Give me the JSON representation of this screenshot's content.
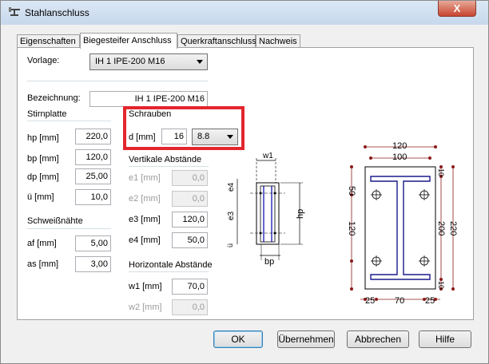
{
  "window": {
    "title": "Stahlanschluss",
    "close_label": "X"
  },
  "tabs": [
    {
      "label": "Eigenschaften"
    },
    {
      "label": "Biegesteifer Anschluss"
    },
    {
      "label": "Querkraftanschluss"
    },
    {
      "label": "Nachweis"
    }
  ],
  "vorlage": {
    "label": "Vorlage:",
    "value": "IH 1 IPE-200 M16"
  },
  "bezeichnung": {
    "label": "Bezeichnung:",
    "value": "IH 1 IPE-200 M16"
  },
  "stirnplatte": {
    "heading": "Stirnplatte",
    "hp": {
      "label": "hp [mm]",
      "value": "220,0"
    },
    "bp": {
      "label": "bp [mm]",
      "value": "120,0"
    },
    "dp": {
      "label": "dp [mm]",
      "value": "25,00"
    },
    "u": {
      "label": "ü [mm]",
      "value": "10,0"
    }
  },
  "schweissnaehte": {
    "heading": "Schweißnähte",
    "af": {
      "label": "af [mm]",
      "value": "5,00"
    },
    "as": {
      "label": "as [mm]",
      "value": "3,00"
    }
  },
  "schrauben": {
    "heading": "Schrauben",
    "d": {
      "label": "d [mm]",
      "value": "16"
    },
    "grade": "8.8"
  },
  "vertikal": {
    "heading": "Vertikale Abstände",
    "e1": {
      "label": "e1 [mm]",
      "value": "0,0"
    },
    "e2": {
      "label": "e2 [mm]",
      "value": "0,0"
    },
    "e3": {
      "label": "e3 [mm]",
      "value": "120,0"
    },
    "e4": {
      "label": "e4 [mm]",
      "value": "50,0"
    }
  },
  "horizontal": {
    "heading": "Horizontale Abstände",
    "w1": {
      "label": "w1 [mm]",
      "value": "70,0"
    },
    "w2": {
      "label": "w2 [mm]",
      "value": "0,0"
    }
  },
  "side_view": {
    "w1": "w1",
    "e4": "e4",
    "e3": "e3",
    "hp": "hp",
    "u": "ü",
    "bp": "bp"
  },
  "front_view": {
    "top_width": "120",
    "flange_width": "100",
    "dim_50": "50",
    "dim_120": "120",
    "dim_220": "220",
    "dim_200": "200",
    "dim_10_top": "10",
    "dim_10_bottom": "10",
    "bottom_left": "25",
    "bottom_mid": "70",
    "bottom_right": "25"
  },
  "buttons": {
    "ok": "OK",
    "apply": "Übernehmen",
    "cancel": "Abbrechen",
    "help": "Hilfe"
  }
}
